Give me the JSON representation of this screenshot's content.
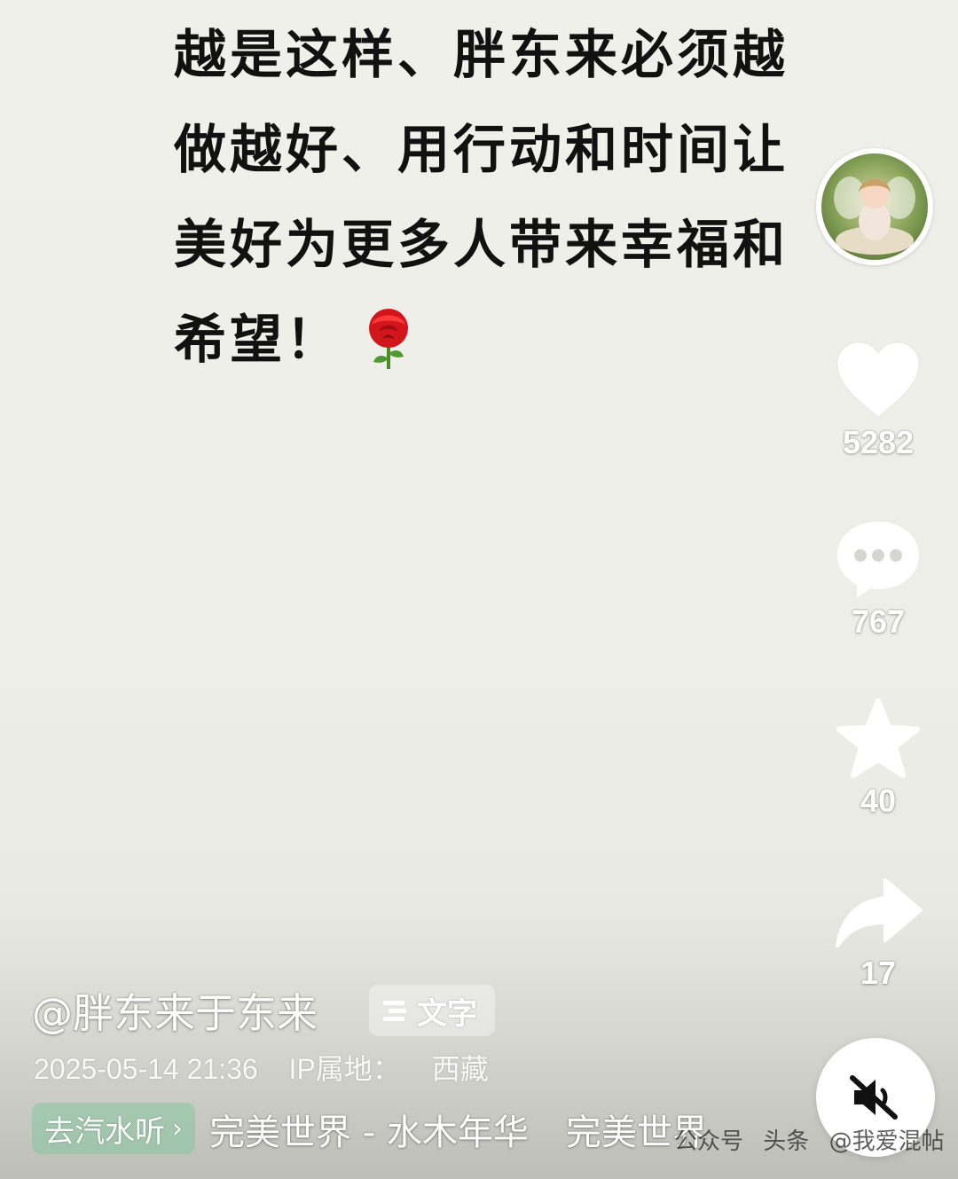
{
  "caption": {
    "lines": [
      "越是这样、胖东来必须越",
      "做越好、用行动和时间让",
      "美好为更多人带来幸福和",
      "希望！"
    ],
    "emoji": "rose-emoji"
  },
  "rail": {
    "avatar": "avatar",
    "like": {
      "icon": "heart-icon",
      "count": "5282"
    },
    "comment": {
      "icon": "comment-icon",
      "count": "767"
    },
    "favorite": {
      "icon": "star-icon",
      "count": "40"
    },
    "share": {
      "icon": "share-icon",
      "count": "17"
    }
  },
  "info": {
    "author": "@胖东来于东来",
    "text_chip_label": "文字",
    "date": "2025-05-14 21:36",
    "ip_label": "IP属地：",
    "ip_value": "西藏",
    "music_chip_label": "去汽水听",
    "music_track": [
      "完美世界 - 水木年华",
      "完美世界"
    ]
  },
  "controls": {
    "mute_icon": "speaker-muted-icon"
  },
  "watermark": {
    "items": [
      "公众号",
      "头条",
      "@我爱混帖"
    ]
  },
  "colors": {
    "background": "#efefe9",
    "text": "#111111",
    "music_chip": "#78c896"
  }
}
